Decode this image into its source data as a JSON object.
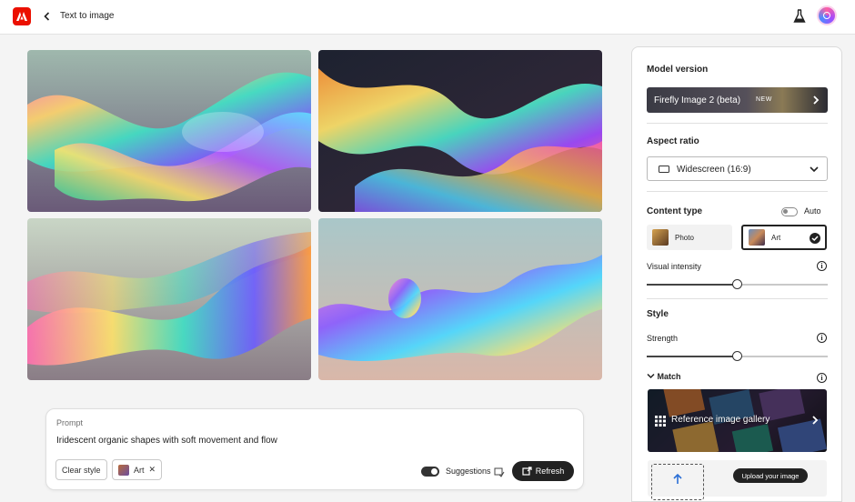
{
  "app": {
    "title": "Text to image"
  },
  "gallery_images": [
    {
      "alt": "iridescent-shape-1"
    },
    {
      "alt": "iridescent-shape-2"
    },
    {
      "alt": "iridescent-shape-3"
    },
    {
      "alt": "iridescent-shape-4"
    }
  ],
  "prompt": {
    "label": "Prompt",
    "text": "Iridescent organic shapes with soft movement and flow",
    "clear_style_label": "Clear style",
    "style_chip_label": "Art",
    "suggestions_label": "Suggestions",
    "suggestions_on": true,
    "refresh_label": "Refresh"
  },
  "panel": {
    "model_version": {
      "heading": "Model version",
      "value": "Firefly Image 2 (beta)",
      "badge": "NEW"
    },
    "aspect_ratio": {
      "heading": "Aspect ratio",
      "value": "Widescreen (16:9)"
    },
    "content_type": {
      "heading": "Content type",
      "auto_label": "Auto",
      "auto_on": false,
      "options": [
        {
          "label": "Photo",
          "selected": false
        },
        {
          "label": "Art",
          "selected": true
        }
      ]
    },
    "visual_intensity": {
      "label": "Visual intensity",
      "level": 0.5
    },
    "style": {
      "heading": "Style",
      "strength_label": "Strength",
      "strength_level": 0.5,
      "match_label": "Match",
      "gallery_label": "Reference image gallery",
      "upload_label": "Upload your image"
    }
  },
  "colors": {
    "brand": "#eb1000",
    "dark": "#222222"
  }
}
